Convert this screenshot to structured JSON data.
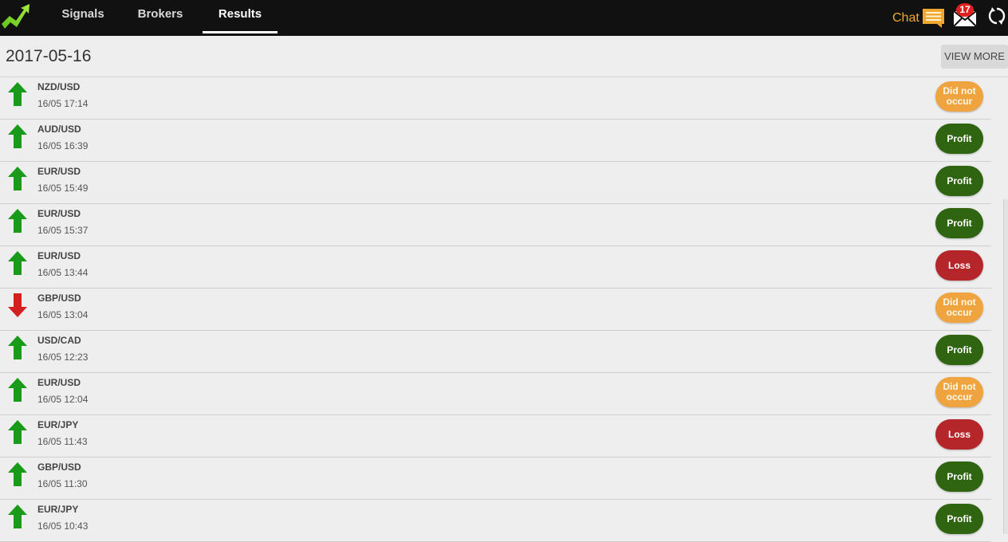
{
  "nav": {
    "tabs": [
      {
        "label": "Signals",
        "active": false
      },
      {
        "label": "Brokers",
        "active": false
      },
      {
        "label": "Results",
        "active": true
      }
    ],
    "chat_label": "Chat",
    "mail_badge": "17"
  },
  "header": {
    "date": "2017-05-16",
    "view_more_label": "VIEW MORE"
  },
  "colors": {
    "profit": "#2f6410",
    "loss": "#b5262a",
    "did_not_occur": "#f0a440",
    "arrow_up": "#1a9a1a",
    "arrow_down": "#d42020",
    "accent": "#f0a830"
  },
  "results": [
    {
      "pair": "NZD/USD",
      "time": "16/05 17:14",
      "direction": "up",
      "status": "Did not occur",
      "status_type": "noccur"
    },
    {
      "pair": "AUD/USD",
      "time": "16/05 16:39",
      "direction": "up",
      "status": "Profit",
      "status_type": "profit"
    },
    {
      "pair": "EUR/USD",
      "time": "16/05 15:49",
      "direction": "up",
      "status": "Profit",
      "status_type": "profit"
    },
    {
      "pair": "EUR/USD",
      "time": "16/05 15:37",
      "direction": "up",
      "status": "Profit",
      "status_type": "profit"
    },
    {
      "pair": "EUR/USD",
      "time": "16/05 13:44",
      "direction": "up",
      "status": "Loss",
      "status_type": "loss"
    },
    {
      "pair": "GBP/USD",
      "time": "16/05 13:04",
      "direction": "down",
      "status": "Did not occur",
      "status_type": "noccur"
    },
    {
      "pair": "USD/CAD",
      "time": "16/05 12:23",
      "direction": "up",
      "status": "Profit",
      "status_type": "profit"
    },
    {
      "pair": "EUR/USD",
      "time": "16/05 12:04",
      "direction": "up",
      "status": "Did not occur",
      "status_type": "noccur"
    },
    {
      "pair": "EUR/JPY",
      "time": "16/05 11:43",
      "direction": "up",
      "status": "Loss",
      "status_type": "loss"
    },
    {
      "pair": "GBP/USD",
      "time": "16/05 11:30",
      "direction": "up",
      "status": "Profit",
      "status_type": "profit"
    },
    {
      "pair": "EUR/JPY",
      "time": "16/05 10:43",
      "direction": "up",
      "status": "Profit",
      "status_type": "profit"
    }
  ]
}
